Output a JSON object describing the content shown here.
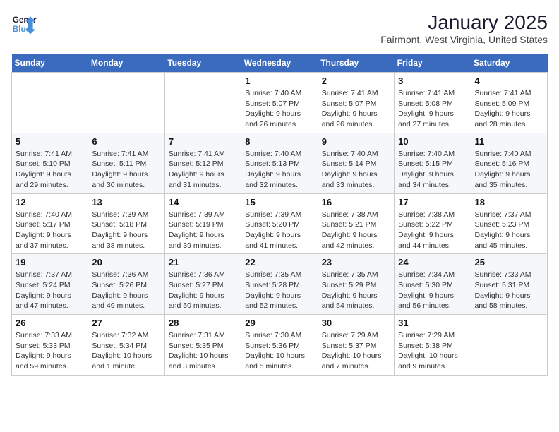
{
  "header": {
    "logo_line1": "General",
    "logo_line2": "Blue",
    "title": "January 2025",
    "subtitle": "Fairmont, West Virginia, United States"
  },
  "days_of_week": [
    "Sunday",
    "Monday",
    "Tuesday",
    "Wednesday",
    "Thursday",
    "Friday",
    "Saturday"
  ],
  "weeks": [
    [
      {
        "day": "",
        "info": ""
      },
      {
        "day": "",
        "info": ""
      },
      {
        "day": "",
        "info": ""
      },
      {
        "day": "1",
        "info": "Sunrise: 7:40 AM\nSunset: 5:07 PM\nDaylight: 9 hours and 26 minutes."
      },
      {
        "day": "2",
        "info": "Sunrise: 7:41 AM\nSunset: 5:07 PM\nDaylight: 9 hours and 26 minutes."
      },
      {
        "day": "3",
        "info": "Sunrise: 7:41 AM\nSunset: 5:08 PM\nDaylight: 9 hours and 27 minutes."
      },
      {
        "day": "4",
        "info": "Sunrise: 7:41 AM\nSunset: 5:09 PM\nDaylight: 9 hours and 28 minutes."
      }
    ],
    [
      {
        "day": "5",
        "info": "Sunrise: 7:41 AM\nSunset: 5:10 PM\nDaylight: 9 hours and 29 minutes."
      },
      {
        "day": "6",
        "info": "Sunrise: 7:41 AM\nSunset: 5:11 PM\nDaylight: 9 hours and 30 minutes."
      },
      {
        "day": "7",
        "info": "Sunrise: 7:41 AM\nSunset: 5:12 PM\nDaylight: 9 hours and 31 minutes."
      },
      {
        "day": "8",
        "info": "Sunrise: 7:40 AM\nSunset: 5:13 PM\nDaylight: 9 hours and 32 minutes."
      },
      {
        "day": "9",
        "info": "Sunrise: 7:40 AM\nSunset: 5:14 PM\nDaylight: 9 hours and 33 minutes."
      },
      {
        "day": "10",
        "info": "Sunrise: 7:40 AM\nSunset: 5:15 PM\nDaylight: 9 hours and 34 minutes."
      },
      {
        "day": "11",
        "info": "Sunrise: 7:40 AM\nSunset: 5:16 PM\nDaylight: 9 hours and 35 minutes."
      }
    ],
    [
      {
        "day": "12",
        "info": "Sunrise: 7:40 AM\nSunset: 5:17 PM\nDaylight: 9 hours and 37 minutes."
      },
      {
        "day": "13",
        "info": "Sunrise: 7:39 AM\nSunset: 5:18 PM\nDaylight: 9 hours and 38 minutes."
      },
      {
        "day": "14",
        "info": "Sunrise: 7:39 AM\nSunset: 5:19 PM\nDaylight: 9 hours and 39 minutes."
      },
      {
        "day": "15",
        "info": "Sunrise: 7:39 AM\nSunset: 5:20 PM\nDaylight: 9 hours and 41 minutes."
      },
      {
        "day": "16",
        "info": "Sunrise: 7:38 AM\nSunset: 5:21 PM\nDaylight: 9 hours and 42 minutes."
      },
      {
        "day": "17",
        "info": "Sunrise: 7:38 AM\nSunset: 5:22 PM\nDaylight: 9 hours and 44 minutes."
      },
      {
        "day": "18",
        "info": "Sunrise: 7:37 AM\nSunset: 5:23 PM\nDaylight: 9 hours and 45 minutes."
      }
    ],
    [
      {
        "day": "19",
        "info": "Sunrise: 7:37 AM\nSunset: 5:24 PM\nDaylight: 9 hours and 47 minutes."
      },
      {
        "day": "20",
        "info": "Sunrise: 7:36 AM\nSunset: 5:26 PM\nDaylight: 9 hours and 49 minutes."
      },
      {
        "day": "21",
        "info": "Sunrise: 7:36 AM\nSunset: 5:27 PM\nDaylight: 9 hours and 50 minutes."
      },
      {
        "day": "22",
        "info": "Sunrise: 7:35 AM\nSunset: 5:28 PM\nDaylight: 9 hours and 52 minutes."
      },
      {
        "day": "23",
        "info": "Sunrise: 7:35 AM\nSunset: 5:29 PM\nDaylight: 9 hours and 54 minutes."
      },
      {
        "day": "24",
        "info": "Sunrise: 7:34 AM\nSunset: 5:30 PM\nDaylight: 9 hours and 56 minutes."
      },
      {
        "day": "25",
        "info": "Sunrise: 7:33 AM\nSunset: 5:31 PM\nDaylight: 9 hours and 58 minutes."
      }
    ],
    [
      {
        "day": "26",
        "info": "Sunrise: 7:33 AM\nSunset: 5:33 PM\nDaylight: 9 hours and 59 minutes."
      },
      {
        "day": "27",
        "info": "Sunrise: 7:32 AM\nSunset: 5:34 PM\nDaylight: 10 hours and 1 minute."
      },
      {
        "day": "28",
        "info": "Sunrise: 7:31 AM\nSunset: 5:35 PM\nDaylight: 10 hours and 3 minutes."
      },
      {
        "day": "29",
        "info": "Sunrise: 7:30 AM\nSunset: 5:36 PM\nDaylight: 10 hours and 5 minutes."
      },
      {
        "day": "30",
        "info": "Sunrise: 7:29 AM\nSunset: 5:37 PM\nDaylight: 10 hours and 7 minutes."
      },
      {
        "day": "31",
        "info": "Sunrise: 7:29 AM\nSunset: 5:38 PM\nDaylight: 10 hours and 9 minutes."
      },
      {
        "day": "",
        "info": ""
      }
    ]
  ]
}
